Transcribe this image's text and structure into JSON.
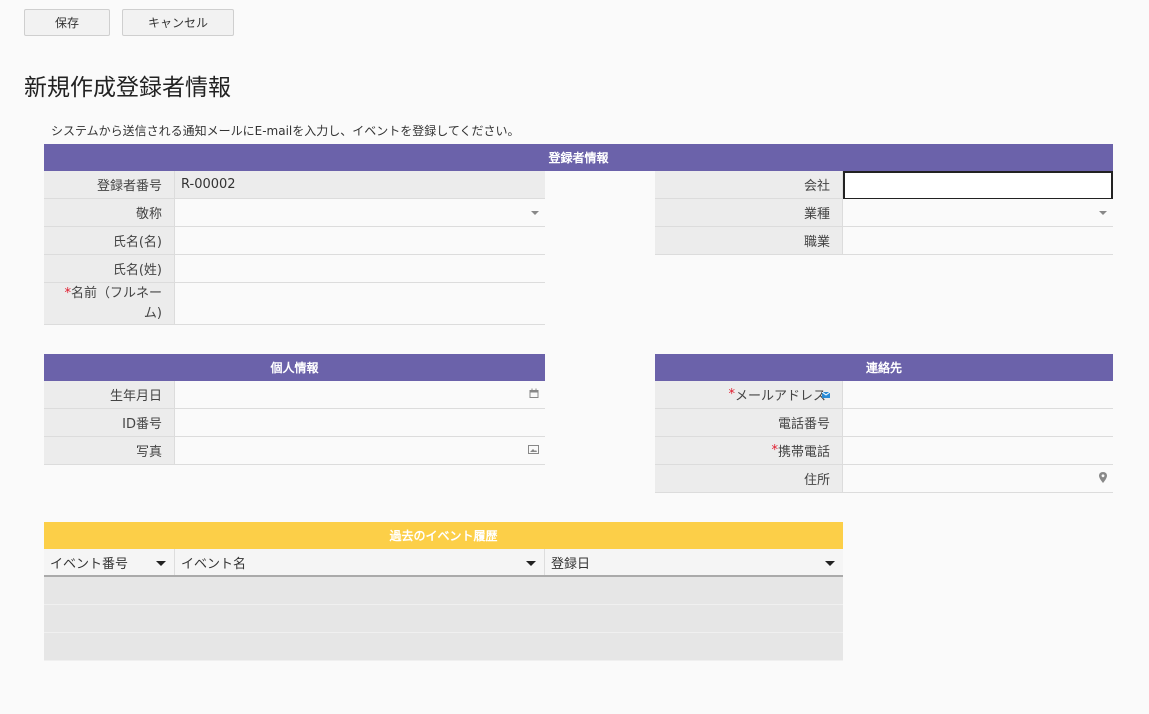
{
  "toolbar": {
    "save_label": "保存",
    "cancel_label": "キャンセル"
  },
  "page_title": "新規作成登録者情報",
  "intro_text": "システムから送信される通知メールにE-mailを入力し、イベントを登録してください。",
  "sections": {
    "registrant": {
      "title": "登録者情報",
      "left": [
        {
          "label": "登録者番号",
          "value": "R-00002"
        },
        {
          "label": "敬称",
          "value": ""
        },
        {
          "label": "氏名(名)",
          "value": ""
        },
        {
          "label": "氏名(姓)",
          "value": ""
        },
        {
          "label_req": "*",
          "label": "名前（フルネーム)",
          "value": ""
        }
      ],
      "right": [
        {
          "label": "会社",
          "value": ""
        },
        {
          "label": "業種",
          "value": ""
        },
        {
          "label": "職業",
          "value": ""
        }
      ]
    },
    "personal": {
      "title": "個人情報",
      "rows": [
        {
          "label": "生年月日",
          "value": ""
        },
        {
          "label": "ID番号",
          "value": ""
        },
        {
          "label": "写真",
          "value": ""
        }
      ]
    },
    "contact": {
      "title": "連絡先",
      "rows": [
        {
          "label_req": "*",
          "label": "メールアドレス",
          "value": ""
        },
        {
          "label": "電話番号",
          "value": ""
        },
        {
          "label_req": "*",
          "label": "携帯電話",
          "value": ""
        },
        {
          "label": "住所",
          "value": ""
        }
      ]
    },
    "events": {
      "title": "過去のイベント履歴",
      "columns": [
        "イベント番号",
        "イベント名",
        "登録日"
      ]
    }
  },
  "icons": {
    "calendar": "calendar-icon",
    "image": "image-icon",
    "mail": "mail-icon",
    "location": "map-pin-icon",
    "dropdown": "chevron-down-icon"
  },
  "colors": {
    "section_purple": "#6b62aa",
    "section_yellow": "#fccf48",
    "required": "#e0192b"
  }
}
